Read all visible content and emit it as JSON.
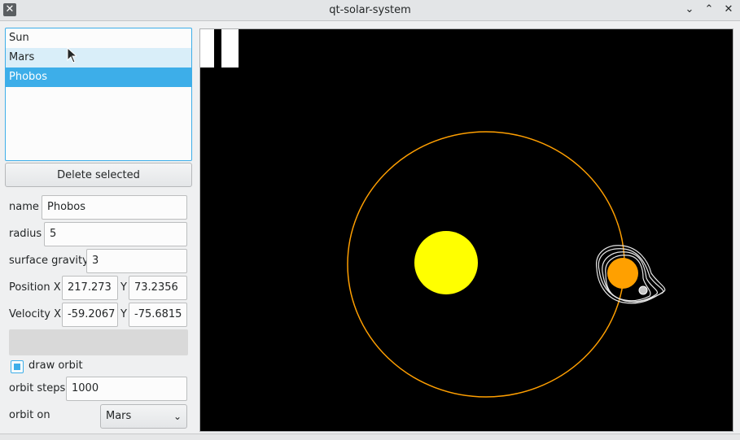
{
  "window": {
    "title": "qt-solar-system",
    "icon": "x-app-icon",
    "controls": {
      "minimize": "chevron-down-icon",
      "maximize": "chevron-up-icon",
      "close": "close-icon"
    }
  },
  "body_list": {
    "items": [
      {
        "label": "Sun",
        "state": "normal"
      },
      {
        "label": "Mars",
        "state": "hover"
      },
      {
        "label": "Phobos",
        "state": "selected"
      }
    ]
  },
  "actions": {
    "delete_label": "Delete selected"
  },
  "form": {
    "name_label": "name",
    "name_value": "Phobos",
    "radius_label": "radius",
    "radius_value": "5",
    "gravity_label": "surface gravity",
    "gravity_value": "3",
    "position_label": "Position X",
    "position_x": "217.273",
    "position_y_label": "Y",
    "position_y": "73.2356",
    "velocity_label": "Velocity X",
    "velocity_x": "-59.2067",
    "velocity_y_label": "Y",
    "velocity_y": "-75.6815",
    "body_color": "#d9d9d9",
    "draw_orbit_label": "draw orbit",
    "draw_orbit_checked": true,
    "orbit_steps_label": "orbit steps",
    "orbit_steps_value": "1000",
    "orbit_on_label": "orbit on",
    "orbit_on_value": "Mars"
  },
  "canvas": {
    "pause_icon": "pause-icon",
    "colors": {
      "background": "#000000",
      "sun": "#ffff00",
      "mars": "#ff9f00",
      "orbit": "#ff9f00",
      "phobos_orbit": "#e0e0e0",
      "phobos": "#c8c8c8"
    }
  }
}
